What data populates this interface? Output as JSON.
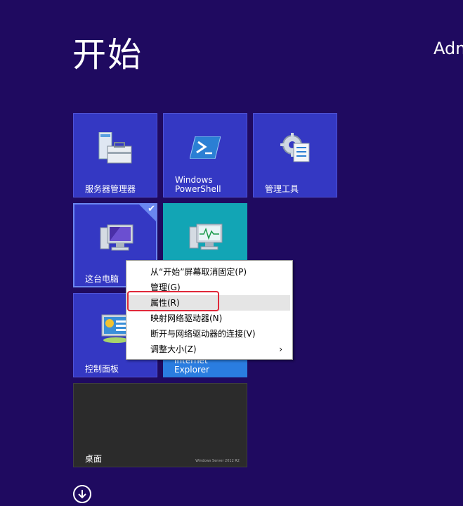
{
  "start": {
    "title": "开始",
    "user": "Adm"
  },
  "tiles": {
    "server_manager": "服务器管理器",
    "powershell": "Windows\nPowerShell",
    "admin_tools": "管理工具",
    "this_pc": "这台电脑",
    "control_panel": "控制面板",
    "ie": "Internet\nExplorer",
    "desktop": "桌面",
    "desktop_brand": "Windows Server 2012 R2"
  },
  "context_menu": {
    "items": [
      "从“开始”屏幕取消固定(P)",
      "管理(G)",
      "属性(R)",
      "映射网络驱动器(N)",
      "断开与网络驱动器的连接(V)",
      "调整大小(Z)"
    ],
    "submenu_arrow": "›",
    "highlighted_index": 2
  },
  "colors": {
    "background": "#1f0a60",
    "tile_blue": "#3438c3",
    "tile_teal": "#12a5b5",
    "tile_dark": "#2b2b2b",
    "highlight_box": "#e0293a"
  },
  "icons": {
    "checkmark": "checkmark-icon",
    "all_apps": "arrow-down-circle-icon"
  }
}
